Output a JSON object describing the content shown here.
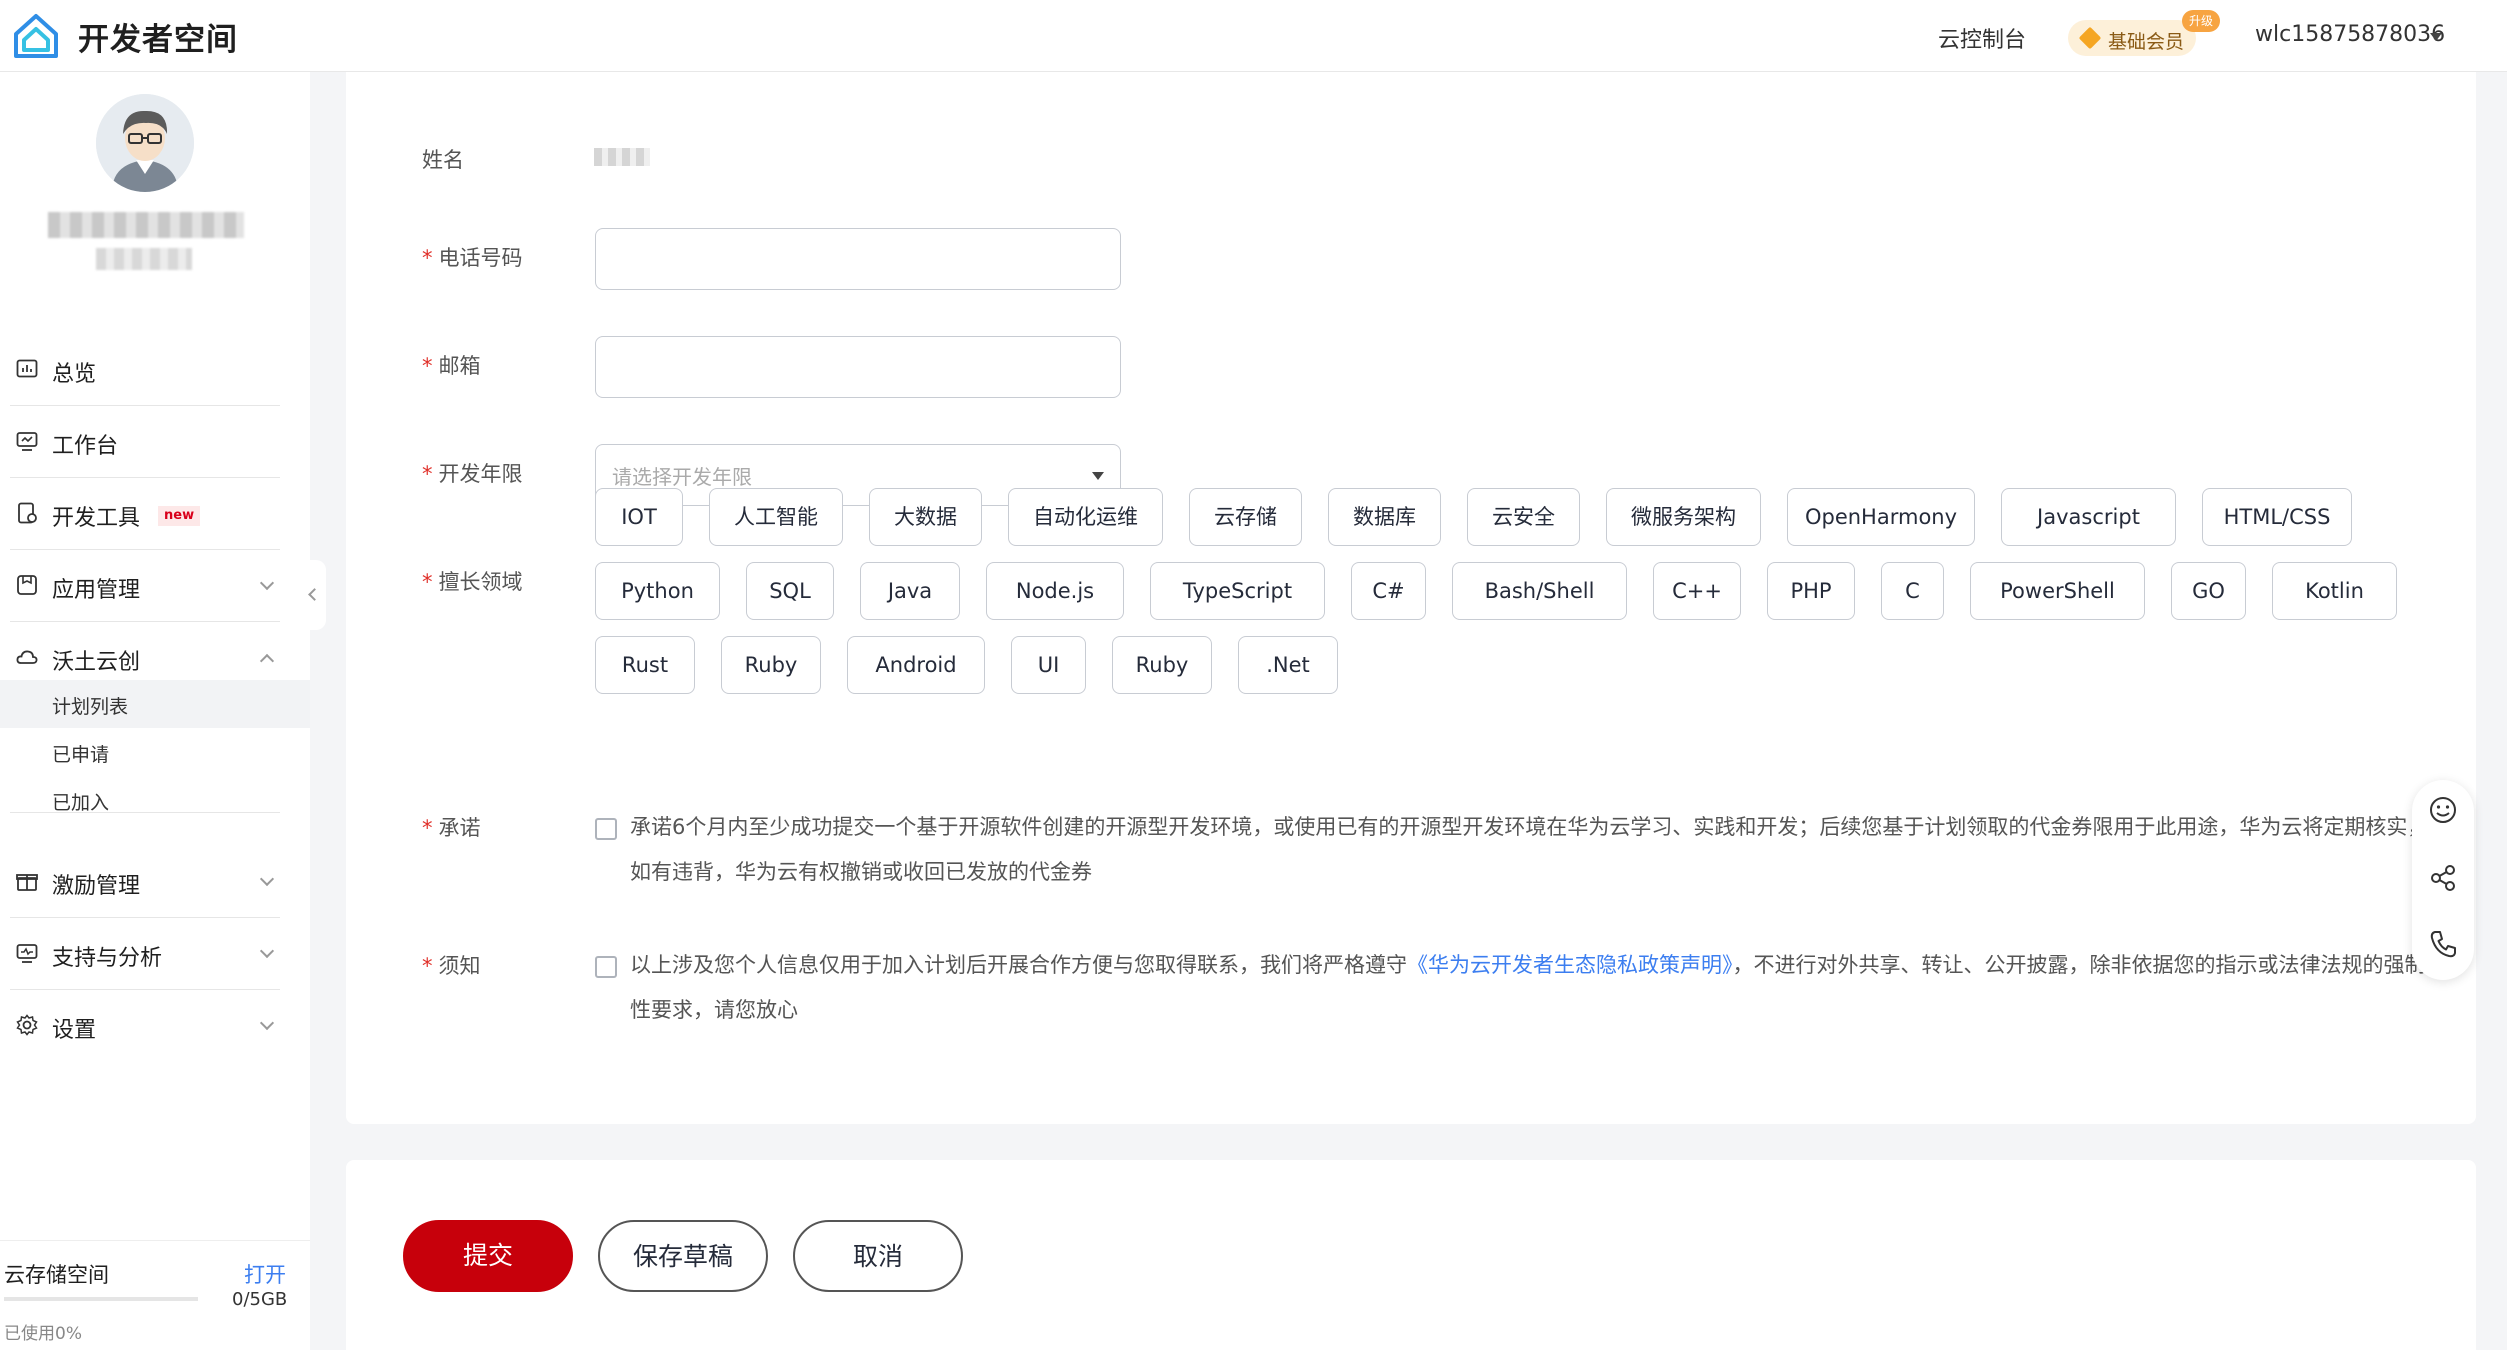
{
  "header": {
    "brand": "开发者空间",
    "console_link": "云控制台",
    "membership": "基础会员",
    "upgrade_badge": "升级",
    "username": "wlc15875878036"
  },
  "sidebar": {
    "items": [
      {
        "label": "总览"
      },
      {
        "label": "工作台"
      },
      {
        "label": "开发工具",
        "badge": "new"
      },
      {
        "label": "应用管理"
      },
      {
        "label": "沃土云创"
      },
      {
        "label": "激励管理"
      },
      {
        "label": "支持与分析"
      },
      {
        "label": "设置"
      }
    ],
    "sub_items": [
      {
        "label": "计划列表"
      },
      {
        "label": "已申请"
      },
      {
        "label": "已加入"
      }
    ],
    "storage": {
      "title": "云存储空间",
      "open": "打开",
      "size": "0/5GB",
      "used": "已使用0%"
    }
  },
  "form": {
    "name_label": "姓名",
    "phone_label": "电话号码",
    "email_label": "邮箱",
    "years_label": "开发年限",
    "years_placeholder": "请选择开发年限",
    "skills_label": "擅长领域",
    "skills": [
      "IOT",
      "人工智能",
      "大数据",
      "自动化运维",
      "云存储",
      "数据库",
      "云安全",
      "微服务架构",
      "OpenHarmony",
      "Javascript",
      "HTML/CSS",
      "Python",
      "SQL",
      "Java",
      "Node.js",
      "TypeScript",
      "C#",
      "Bash/Shell",
      "C++",
      "PHP",
      "C",
      "PowerShell",
      "GO",
      "Kotlin",
      "Rust",
      "Ruby",
      "Android",
      "UI",
      "Ruby",
      ".Net"
    ],
    "promise_label": "承诺",
    "promise_text": "承诺6个月内至少成功提交一个基于开源软件创建的开源型开发环境，或使用已有的开源型开发环境在华为云学习、实践和开发；后续您基于计划领取的代金券限用于此用途，华为云将定期核实，如有违背，华为云有权撤销或收回已发放的代金券",
    "notice_label": "须知",
    "notice_text_before": "以上涉及您个人信息仅用于加入计划后开展合作方便与您取得联系，我们将严格遵守",
    "notice_link": "《华为云开发者生态隐私政策声明》",
    "notice_text_after": "，不进行对外共享、转让、公开披露，除非依据您的指示或法律法规的强制性要求，请您放心"
  },
  "actions": {
    "submit": "提交",
    "save_draft": "保存草稿",
    "cancel": "取消"
  }
}
